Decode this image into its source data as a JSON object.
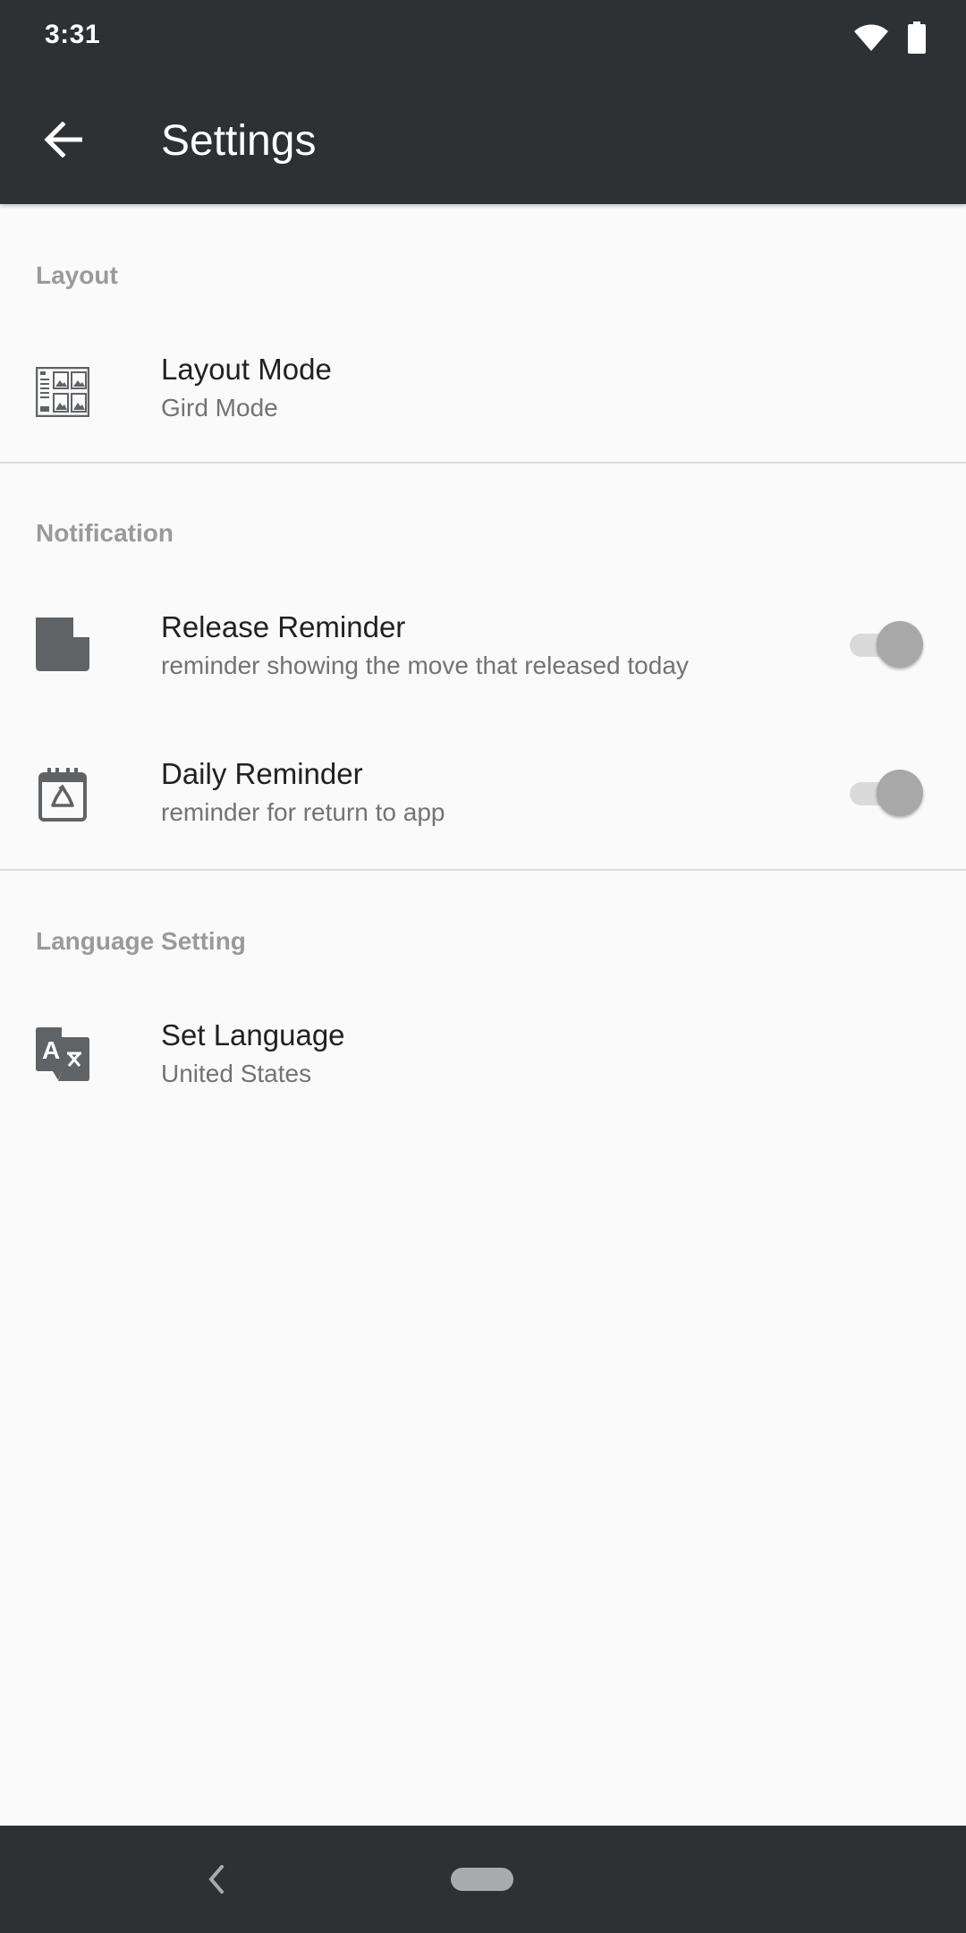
{
  "status_bar": {
    "time": "3:31",
    "icons": [
      "wifi-icon",
      "battery-icon"
    ]
  },
  "toolbar": {
    "title": "Settings",
    "back_icon": "arrow-back-icon"
  },
  "sections": {
    "layout": {
      "header": "Layout",
      "items": [
        {
          "title": "Layout Mode",
          "summary": "Gird Mode",
          "icon": "grid-layout-icon"
        }
      ]
    },
    "notification": {
      "header": "Notification",
      "items": [
        {
          "title": "Release Reminder",
          "summary": "reminder showing the move that released today",
          "icon": "note-icon",
          "enabled": false
        },
        {
          "title": "Daily Reminder",
          "summary": "reminder for return to app",
          "icon": "calendar-recycle-icon",
          "enabled": false
        }
      ]
    },
    "language": {
      "header": "Language Setting",
      "items": [
        {
          "title": "Set Language",
          "summary": "United States",
          "icon": "translate-icon"
        }
      ]
    }
  },
  "colors": {
    "app_bar": "#2e3134",
    "background": "#fafafa",
    "section_header": "#9a9a9a",
    "title_text": "#212121",
    "summary_text": "#737373",
    "icon": "#5f6366"
  },
  "nav_bar": {
    "icons": [
      "nav-back-icon",
      "nav-home-pill"
    ]
  }
}
